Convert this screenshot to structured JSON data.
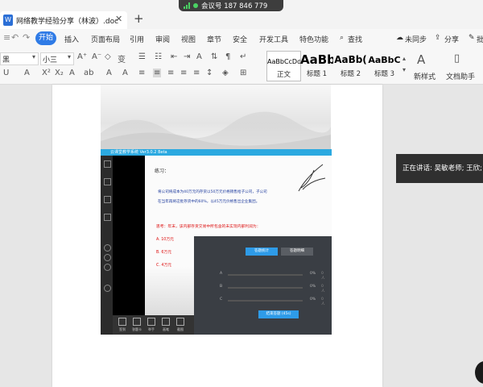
{
  "titlebar": {
    "doc_icon": "W",
    "doc_title": "网络教学经验分享（林波）.doc",
    "close_glyph": "✕",
    "add_glyph": "+",
    "meeting_label": "会议号 187 846 779"
  },
  "menubar": {
    "start": "开始",
    "items": [
      "插入",
      "页面布局",
      "引用",
      "审阅",
      "视图",
      "章节",
      "安全",
      "开发工具",
      "特色功能",
      "查找"
    ],
    "right": {
      "sync": "未同步",
      "share": "分享",
      "batch": "批"
    }
  },
  "ribbon": {
    "font_name": "黑",
    "font_size": "小三",
    "styles": [
      {
        "sample": "AaBbCcDd",
        "label": "正文"
      },
      {
        "sample": "AaBb",
        "label": "标题 1"
      },
      {
        "sample": "AaBb(",
        "label": "标题 2"
      },
      {
        "sample": "AaBbC",
        "label": "标题 3"
      }
    ],
    "new_style_sample": "A",
    "new_style": "新样式",
    "doc_helper": "文档助手"
  },
  "slide": {
    "app_title": "云课堂教学系统 Ver3.0.2 Beta",
    "practice_label": "练习：",
    "question_line1": "将公司将成本为40万元的存货以50万元价格销售给子公司，子公司",
    "question_line2": "在当年再将这批存货中的60%，以45万元价格售出企业集团。",
    "think_label": "思考：年末，该内部存货交易中所包含的未实现内部利润为：",
    "options": [
      "A. 10万元",
      "B. 6万元",
      "C. 4万元"
    ],
    "bottom_buttons": [
      "签到",
      "答题卡",
      "举手",
      "画笔",
      "截图"
    ]
  },
  "answer_panel": {
    "tab_stats": "答题统计",
    "tab_detail": "答题明细",
    "rows": [
      {
        "label": "A",
        "value": "0%",
        "people": "0人"
      },
      {
        "label": "B",
        "value": "0%",
        "people": "0人"
      },
      {
        "label": "C",
        "value": "0%",
        "people": "0人"
      }
    ],
    "end_button": "结束答题 (45s)"
  },
  "speaking": {
    "text": "正在讲话: 吴敏老师; 王欣;"
  },
  "colors": {
    "accent": "#2f7be6",
    "meeting_bg": "#3d3d3d",
    "panel_bg": "#3a3e44",
    "speaking_bg": "#2f2f2f"
  }
}
